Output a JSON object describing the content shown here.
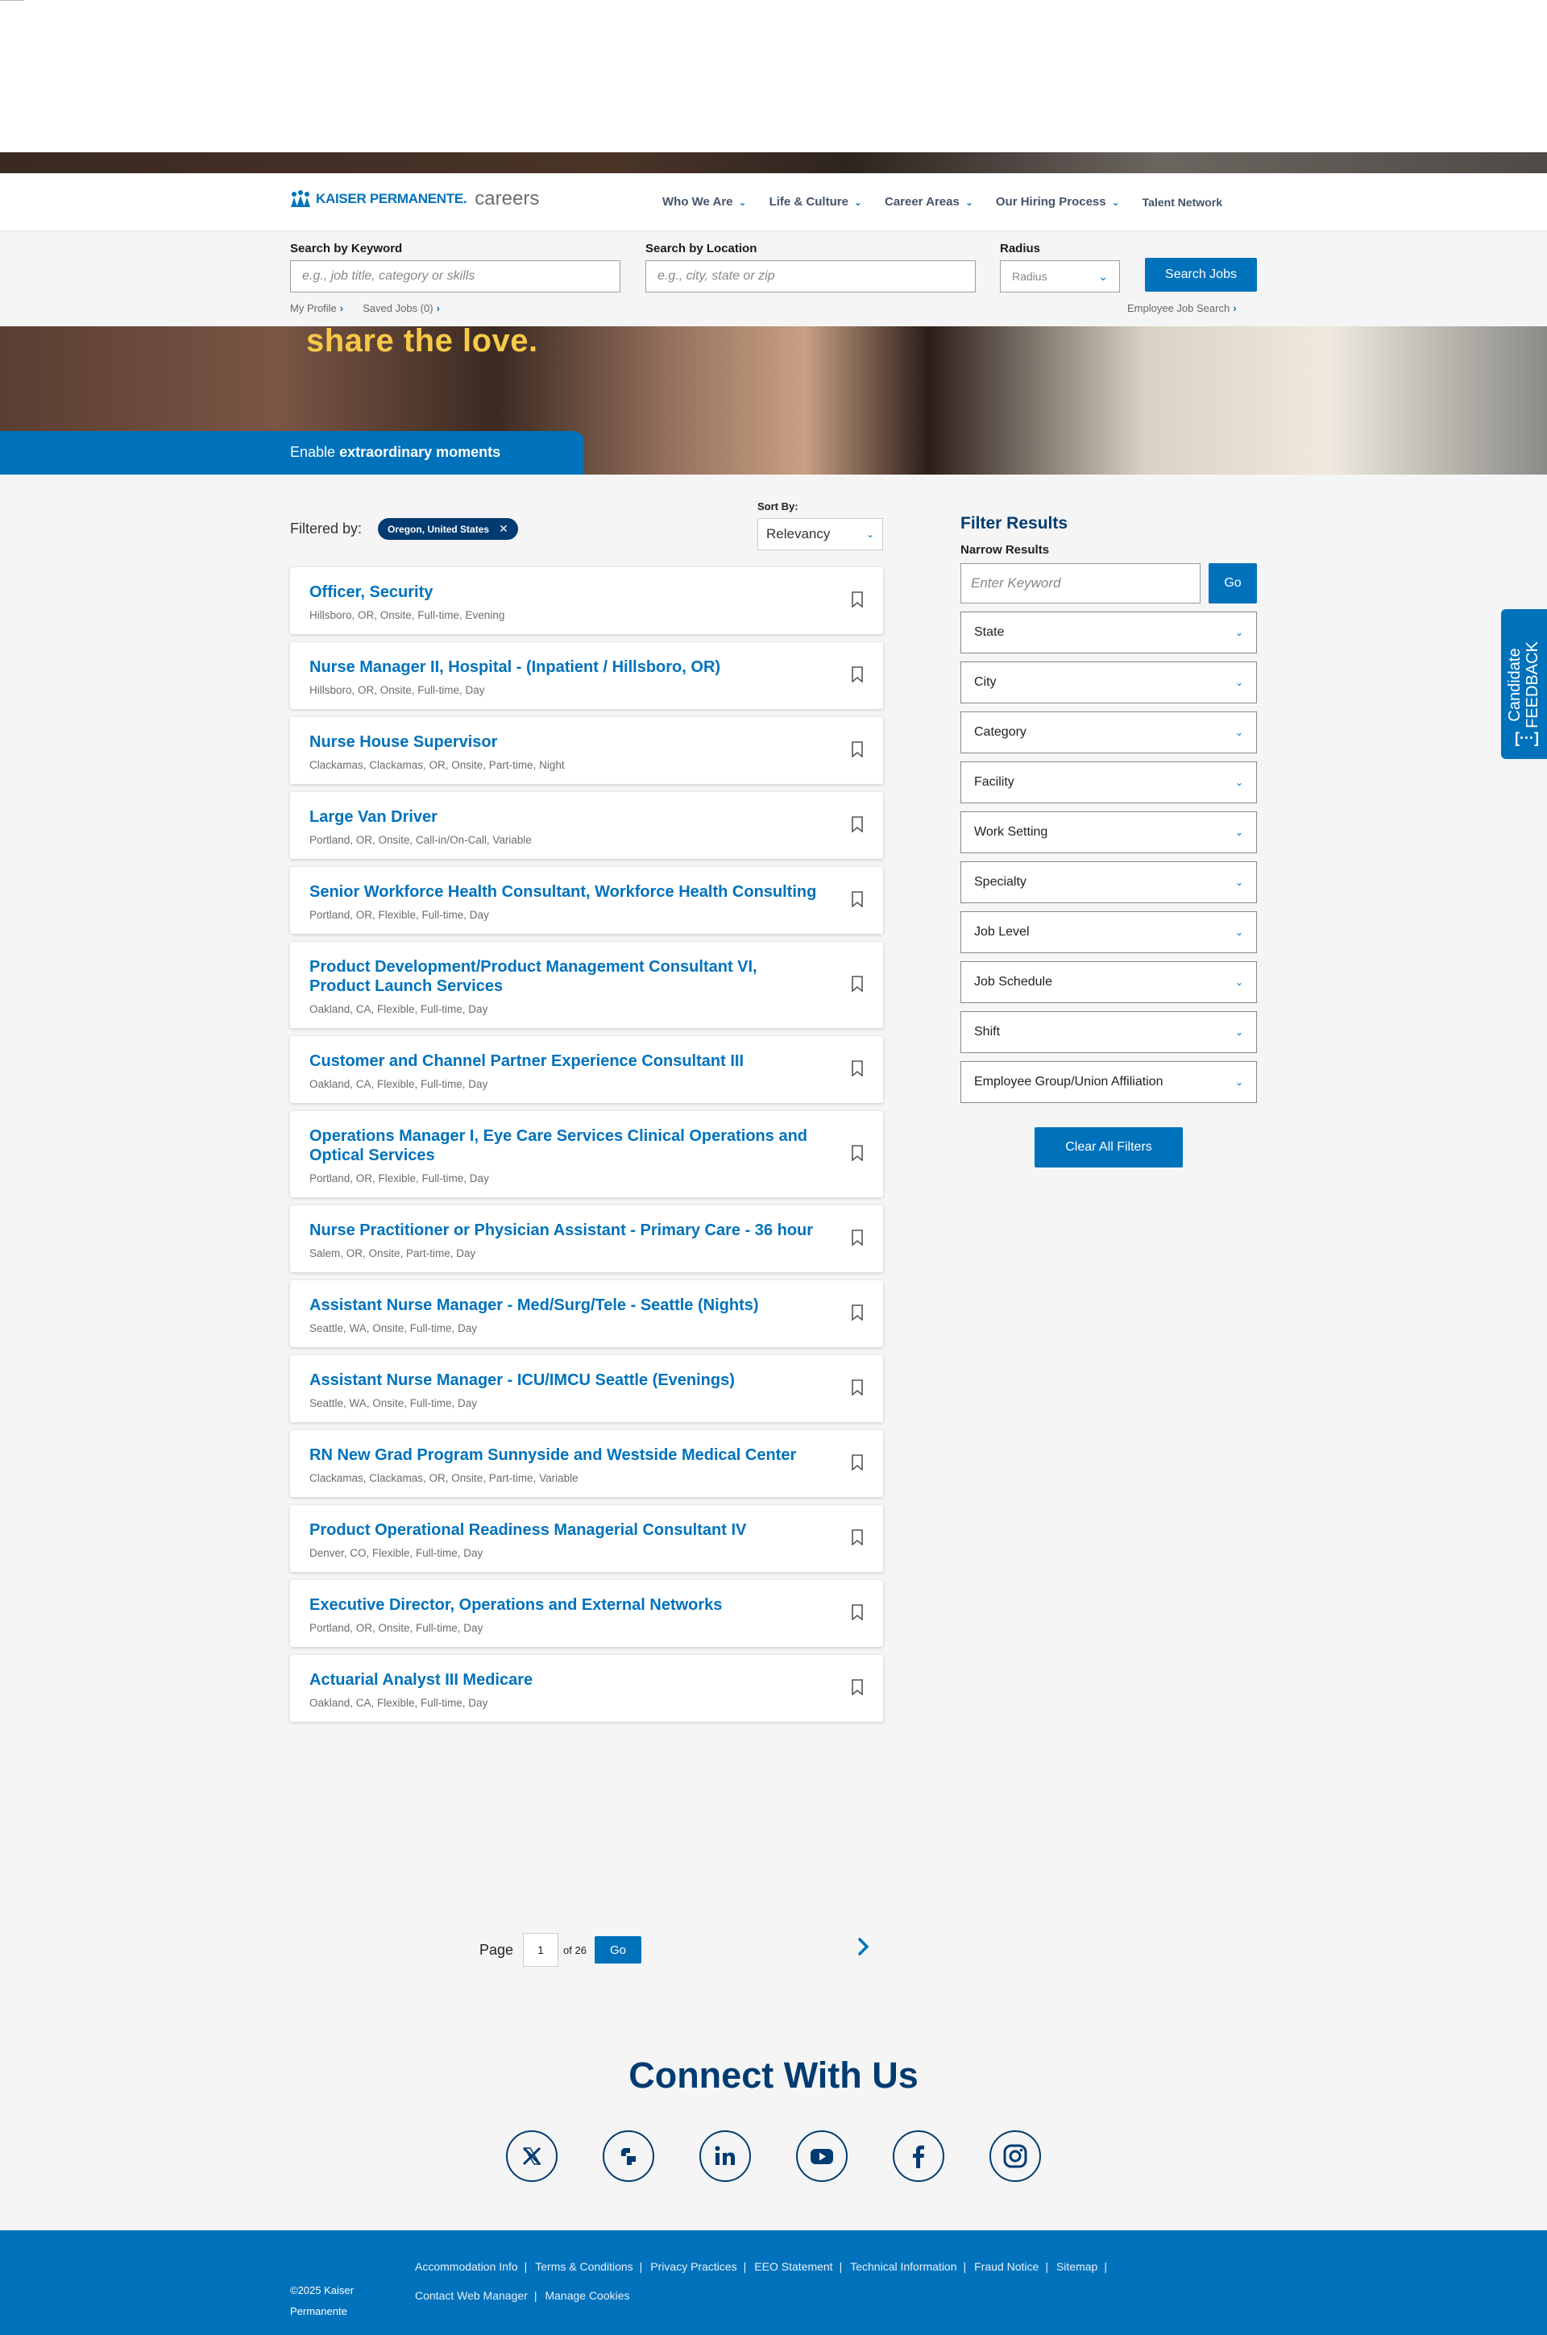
{
  "header": {
    "logo_brand": "KAISER PERMANENTE.",
    "logo_suffix": "careers",
    "nav": [
      {
        "label": "Who We Are",
        "has_dropdown": true
      },
      {
        "label": "Life & Culture",
        "has_dropdown": true
      },
      {
        "label": "Career Areas",
        "has_dropdown": true
      },
      {
        "label": "Our Hiring Process",
        "has_dropdown": true
      },
      {
        "label": "Talent Network",
        "has_dropdown": false
      }
    ]
  },
  "search": {
    "keyword_label": "Search by Keyword",
    "keyword_placeholder": "e.g., job title, category or skills",
    "location_label": "Search by Location",
    "location_placeholder": "e.g., city, state or zip",
    "radius_label": "Radius",
    "radius_value": "Radius",
    "search_button": "Search Jobs",
    "my_profile": "My Profile",
    "saved_jobs": "Saved Jobs (0)",
    "employee_search": "Employee Job Search"
  },
  "hero": {
    "headline": "share the love.",
    "band_prefix": "Enable",
    "band_bold": "extraordinary moments"
  },
  "results": {
    "filtered_by_label": "Filtered by:",
    "active_filter": "Oregon, United States",
    "sort_label": "Sort By:",
    "sort_value": "Relevancy",
    "jobs": [
      {
        "title": "Officer, Security",
        "meta": "Hillsboro, OR, Onsite, Full-time, Evening"
      },
      {
        "title": "Nurse Manager II, Hospital - (Inpatient / Hillsboro, OR)",
        "meta": "Hillsboro, OR, Onsite, Full-time, Day"
      },
      {
        "title": "Nurse House Supervisor",
        "meta": "Clackamas, Clackamas, OR, Onsite, Part-time, Night"
      },
      {
        "title": "Large Van Driver",
        "meta": "Portland, OR, Onsite, Call-in/On-Call, Variable"
      },
      {
        "title": "Senior Workforce Health Consultant, Workforce Health Consulting",
        "meta": "Portland, OR, Flexible, Full-time, Day"
      },
      {
        "title": "Product Development/Product Management Consultant VI, Product Launch Services",
        "meta": "Oakland, CA, Flexible, Full-time, Day"
      },
      {
        "title": "Customer and Channel Partner Experience Consultant III",
        "meta": "Oakland, CA, Flexible, Full-time, Day"
      },
      {
        "title": "Operations Manager I, Eye Care Services Clinical Operations and Optical Services",
        "meta": "Portland, OR, Flexible, Full-time, Day"
      },
      {
        "title": "Nurse Practitioner or Physician Assistant - Primary Care - 36 hour",
        "meta": "Salem, OR, Onsite, Part-time, Day"
      },
      {
        "title": "Assistant Nurse Manager - Med/Surg/Tele - Seattle (Nights)",
        "meta": "Seattle, WA, Onsite, Full-time, Day"
      },
      {
        "title": "Assistant Nurse Manager - ICU/IMCU Seattle (Evenings)",
        "meta": "Seattle, WA, Onsite, Full-time, Day"
      },
      {
        "title": "RN New Grad Program Sunnyside and Westside Medical Center",
        "meta": "Clackamas, Clackamas, OR, Onsite, Part-time, Variable"
      },
      {
        "title": "Product Operational Readiness Managerial Consultant IV",
        "meta": "Denver, CO, Flexible, Full-time, Day"
      },
      {
        "title": "Executive Director, Operations and External Networks",
        "meta": "Portland, OR, Onsite, Full-time, Day"
      },
      {
        "title": "Actuarial Analyst III Medicare",
        "meta": "Oakland, CA, Flexible, Full-time, Day"
      }
    ]
  },
  "pager": {
    "label": "Page",
    "current": "1",
    "of_text": "of 26",
    "go": "Go"
  },
  "filters": {
    "heading": "Filter Results",
    "narrow_label": "Narrow Results",
    "keyword_placeholder": "Enter Keyword",
    "go": "Go",
    "dropdowns": [
      "State",
      "City",
      "Category",
      "Facility",
      "Work Setting",
      "Specialty",
      "Job Level",
      "Job Schedule",
      "Shift",
      "Employee Group/Union Affiliation"
    ],
    "clear_all": "Clear All Filters"
  },
  "feedback": {
    "line1": "Candidate",
    "line2": "FEEDBACK",
    "icon": "[···]"
  },
  "connect": {
    "heading": "Connect With Us",
    "icons": [
      "x-twitter-icon",
      "glassdoor-icon",
      "linkedin-icon",
      "youtube-icon",
      "facebook-icon",
      "instagram-icon"
    ]
  },
  "footer": {
    "copyright_line1": "©2025 Kaiser",
    "copyright_line2": "Permanente",
    "links": [
      "Accommodation Info",
      "Terms & Conditions",
      "Privacy Practices",
      "EEO Statement",
      "Technical Information",
      "Fraud Notice",
      "Sitemap",
      "Contact Web Manager",
      "Manage Cookies"
    ]
  },
  "colors": {
    "brand_blue": "#0072bc",
    "navy": "#003b71",
    "hero_yellow": "#f7c948"
  }
}
